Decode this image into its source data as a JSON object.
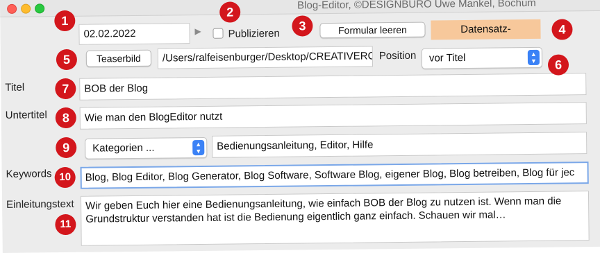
{
  "window": {
    "title": "Blog-Editor, ©DESIGNBÜRO Uwe Mankel, Bochum"
  },
  "row1": {
    "date_value": "02.02.2022",
    "publish_label": "Publizieren",
    "clear_button": "Formular leeren",
    "record_status": "Datensatz-"
  },
  "row2": {
    "teaser_button": "Teaserbild",
    "teaser_path": "/Users/ralfeisenburger/Desktop/CREATIVERC",
    "position_label": "Position",
    "position_value": "vor Titel"
  },
  "title": {
    "label": "Titel",
    "value": "BOB der Blog"
  },
  "subtitle": {
    "label": "Untertitel",
    "value": "Wie man den BlogEditor nutzt"
  },
  "categories": {
    "select_value": "Kategorien ...",
    "value": "Bedienungsanleitung, Editor, Hilfe"
  },
  "keywords": {
    "label": "Keywords",
    "value": "Blog, Blog Editor, Blog Generator, Blog Software, Software Blog, eigener Blog, Blog betreiben, Blog für jec"
  },
  "intro": {
    "label": "Einleitungstext",
    "value": "Wir geben Euch hier eine Bedienungsanleitung, wie einfach BOB der Blog zu nutzen ist. Wenn man die Grundstruktur verstanden hat ist die Bedienung eigentlich ganz einfach. Schauen wir mal…"
  },
  "badges": [
    "1",
    "2",
    "3",
    "4",
    "5",
    "6",
    "7",
    "8",
    "9",
    "10",
    "11"
  ],
  "colors": {
    "badge": "#d3161c",
    "record_status_bg": "#f7c89b",
    "focus_ring": "#7aa7e8",
    "select_arrows": "#3b82f6"
  }
}
